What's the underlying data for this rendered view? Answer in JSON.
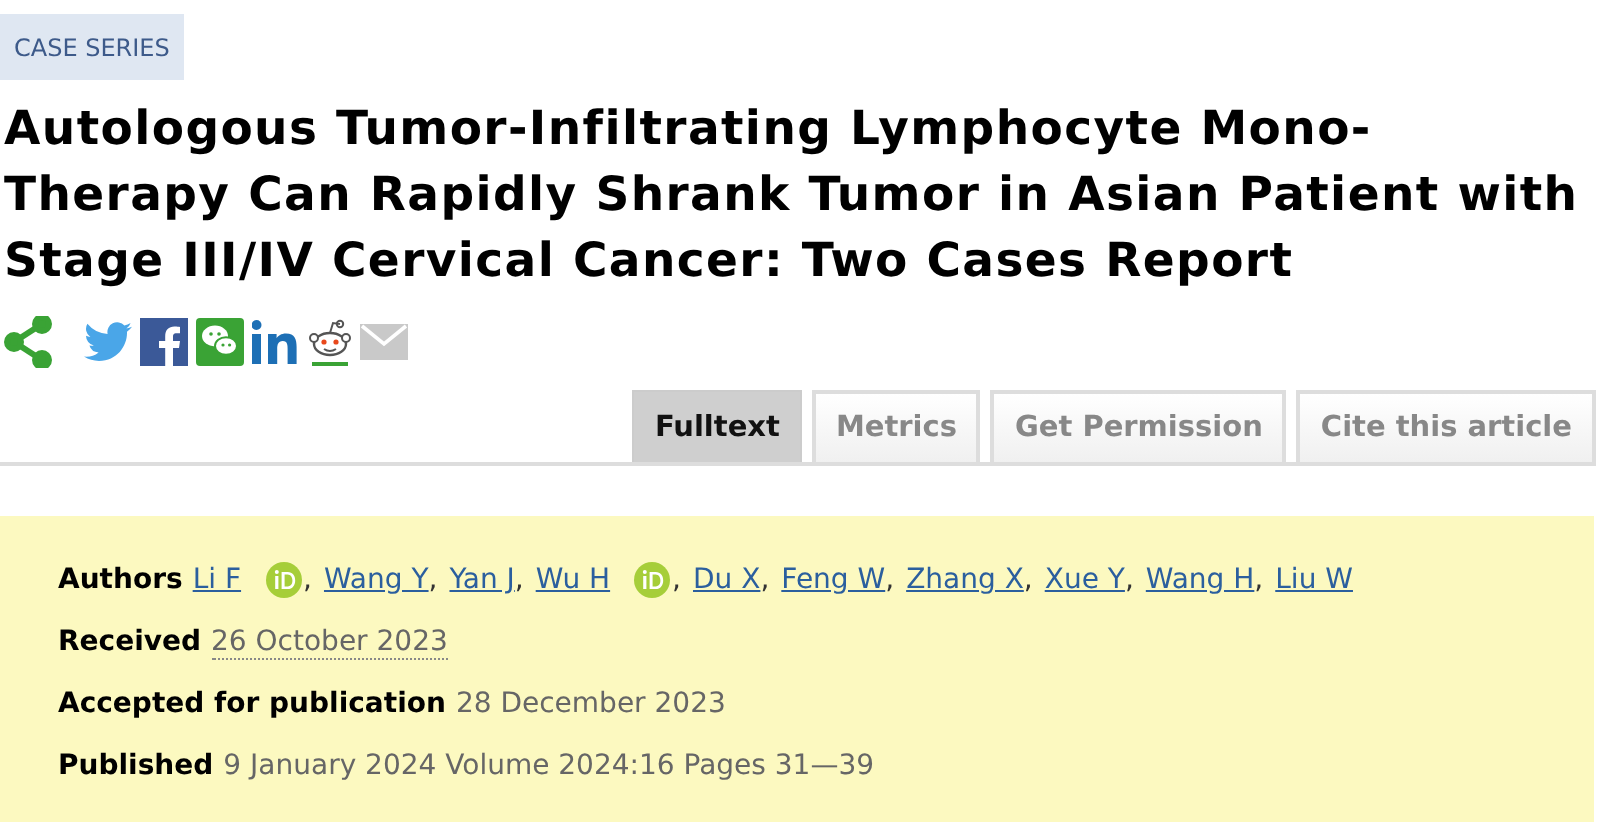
{
  "category": "CASE SERIES",
  "title": "Autologous Tumor-Infiltrating Lymphocyte Mono-Therapy Can Rapidly Shrank Tumor in Asian Patient with Stage III/IV Cervical Cancer: Two Cases Report",
  "tabs": [
    {
      "label": "Fulltext",
      "selected": true
    },
    {
      "label": "Metrics",
      "selected": false
    },
    {
      "label": "Get Permission",
      "selected": false
    },
    {
      "label": "Cite this article",
      "selected": false
    }
  ],
  "details": {
    "authors_label": "Authors",
    "separator": ",",
    "authors": [
      {
        "name": "Li F",
        "orcid": true
      },
      {
        "name": "Wang Y",
        "orcid": false
      },
      {
        "name": "Yan J",
        "orcid": false
      },
      {
        "name": "Wu H",
        "orcid": true
      },
      {
        "name": "Du X",
        "orcid": false
      },
      {
        "name": "Feng W",
        "orcid": false
      },
      {
        "name": "Zhang X",
        "orcid": false
      },
      {
        "name": "Xue Y",
        "orcid": false
      },
      {
        "name": "Wang H",
        "orcid": false
      },
      {
        "name": "Liu W",
        "orcid": false
      }
    ],
    "rows": [
      {
        "label": "Received",
        "value": "26 October 2023",
        "kind": "dotted"
      },
      {
        "label": "Accepted for publication",
        "value": "28 December 2023",
        "kind": "plain"
      },
      {
        "label": "Published",
        "value": "9 January 2024 Volume 2024:16 Pages 31—39",
        "kind": "plain"
      }
    ]
  }
}
